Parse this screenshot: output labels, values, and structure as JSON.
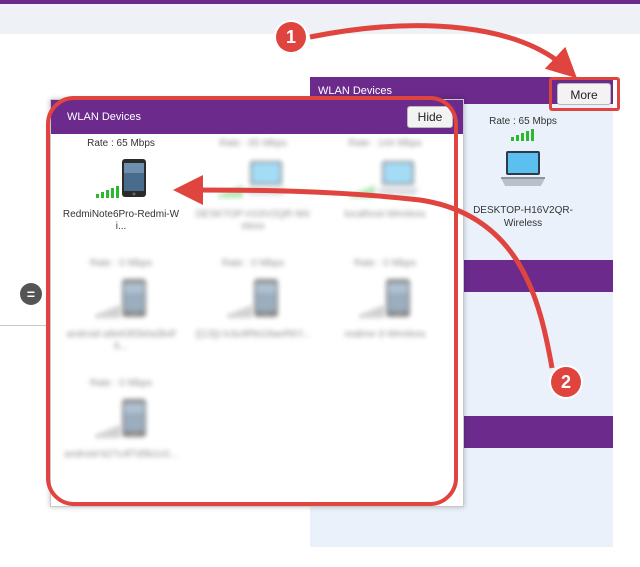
{
  "background_panel": {
    "title": "WLAN Devices",
    "more_label": "More",
    "device": {
      "rate": "Rate : 65 Mbps",
      "name": "DESKTOP-H16V2QR-Wireless"
    }
  },
  "popup": {
    "title": "WLAN Devices",
    "hide_label": "Hide",
    "devices": [
      {
        "rate": "Rate : 65 Mbps",
        "name": "RedmiNote6Pro-Redmi-Wi...",
        "kind": "phone",
        "blurred": false
      },
      {
        "rate": "Rate : 65 Mbps",
        "name": "DESKTOP-H16V2QR-Wireless",
        "kind": "laptop",
        "blurred": true
      },
      {
        "rate": "Rate : 144 Mbps",
        "name": "localhost-Wireless",
        "kind": "laptop",
        "blurred": true
      },
      {
        "rate": "Rate : 0 Mbps",
        "name": "android-a9e63f2b0a3b4f6...",
        "kind": "phone",
        "blurred": true
      },
      {
        "rate": "Rate : 0 Mbps",
        "name": "{{13}}-lv3u9RkG9aeR6Y...",
        "kind": "phone",
        "blurred": true
      },
      {
        "rate": "Rate : 0 Mbps",
        "name": "realme-3-Wireless",
        "kind": "phone",
        "blurred": true
      },
      {
        "rate": "Rate : 0 Mbps",
        "name": "android-b27c4f7d5b1c0...",
        "kind": "phone",
        "blurred": true
      }
    ]
  },
  "annotations": {
    "step1": "1",
    "step2": "2"
  },
  "colors": {
    "accent": "#6b2a8c",
    "annotation": "#e0443e",
    "signal": "#2eb82e"
  }
}
